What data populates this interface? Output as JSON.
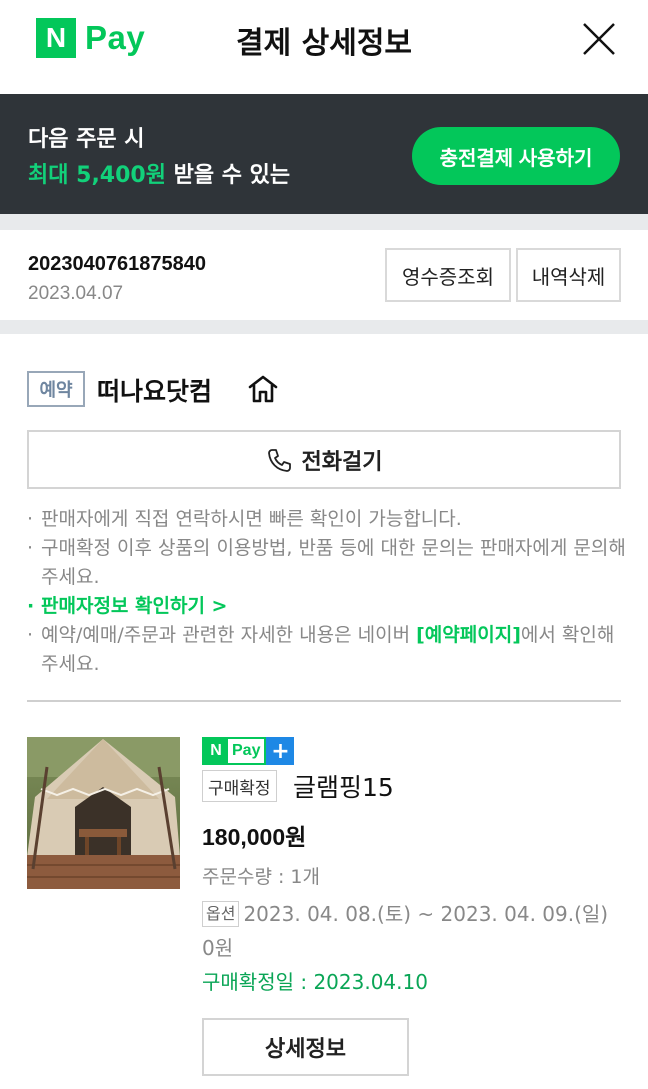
{
  "header": {
    "logo_n": "N",
    "logo_pay": "Pay",
    "title": "결제 상세정보"
  },
  "promo": {
    "line1": "다음 주문 시",
    "line2_highlight": "최대 5,400원",
    "line2_rest": " 받을 수 있는",
    "button_label": "충전결제 사용하기"
  },
  "order": {
    "number": "2023040761875840",
    "date": "2023.04.07",
    "receipt_label": "영수증조회",
    "delete_label": "내역삭제"
  },
  "seller": {
    "badge": "예약",
    "name": "떠나요닷컴",
    "call_label": "전화걸기"
  },
  "notes": {
    "note1": "판매자에게 직접 연락하시면 빠른 확인이 가능합니다.",
    "note2": "구매확정 이후 상품의 이용방법, 반품 등에 대한 문의는 판매자에게 문의해 주세요.",
    "seller_info_link": "판매자정보 확인하기 >",
    "note3_before": "예약/예매/주문과 관련한 자세한 내용은 네이버 ",
    "note3_link": "[예약페이지]",
    "note3_after": "에서 확인해주세요."
  },
  "product": {
    "npay_n": "N",
    "npay_pay": "Pay",
    "npay_plus": "+",
    "status_badge": "구매확정",
    "name": "글램핑15",
    "price": "180,000원",
    "quantity": "주문수량 : 1개",
    "option_badge": "옵션",
    "option_text": "2023. 04. 08.(토) ~ 2023. 04. 09.(일) 0원",
    "confirm_date": "구매확정일 : 2023.04.10",
    "detail_button": "상세정보"
  },
  "colors": {
    "brand_green": "#03c75a",
    "promo_bg": "#2f3439",
    "highlight_green": "#12d17a"
  }
}
